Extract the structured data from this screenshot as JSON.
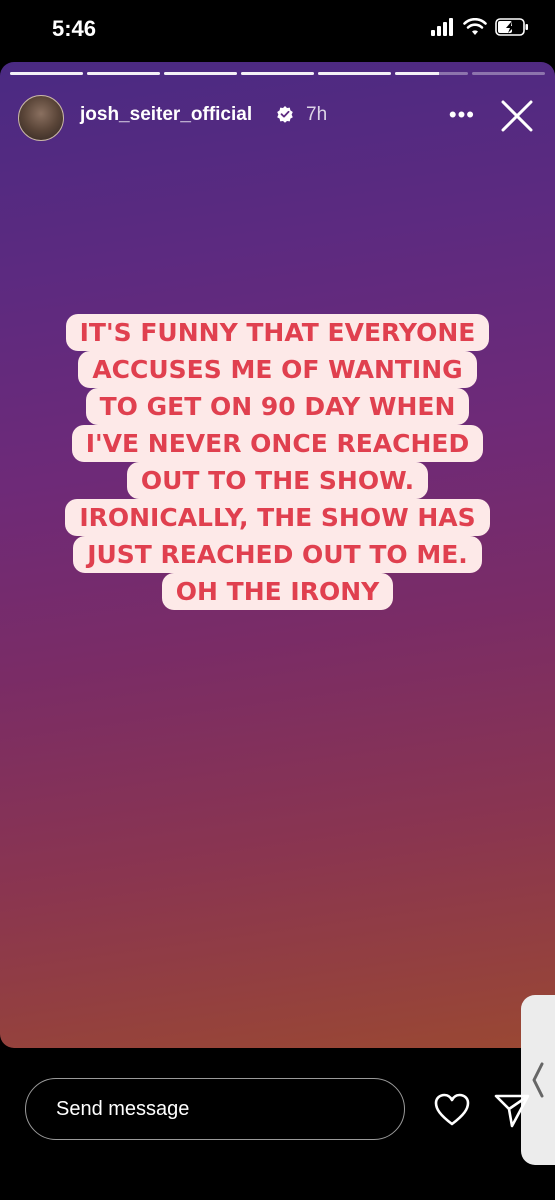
{
  "status_bar": {
    "time": "5:46"
  },
  "story": {
    "progress_segments": [
      1,
      1,
      1,
      1,
      1,
      0.6,
      0
    ],
    "author": {
      "username": "josh_seiter_official",
      "verified": true,
      "time_ago": "7h"
    },
    "more_label": "•••",
    "caption_lines": [
      "IT'S FUNNY THAT EVERYONE",
      "ACCUSES ME OF WANTING",
      "TO GET ON 90 DAY WHEN",
      "I'VE NEVER ONCE REACHED",
      "OUT TO THE SHOW.",
      "IRONICALLY, THE SHOW HAS",
      "JUST REACHED OUT TO ME.",
      "OH THE IRONY"
    ]
  },
  "reply_bar": {
    "placeholder": "Send message"
  },
  "icons": {
    "signal": "signal-icon",
    "wifi": "wifi-icon",
    "battery": "battery-charging-icon",
    "verified": "verified-badge-icon",
    "close": "close-icon",
    "heart": "heart-icon",
    "send": "send-icon",
    "chevron": "chevron-left-icon"
  },
  "colors": {
    "caption_text": "#e0404f",
    "caption_bg": "#fde9e8"
  }
}
